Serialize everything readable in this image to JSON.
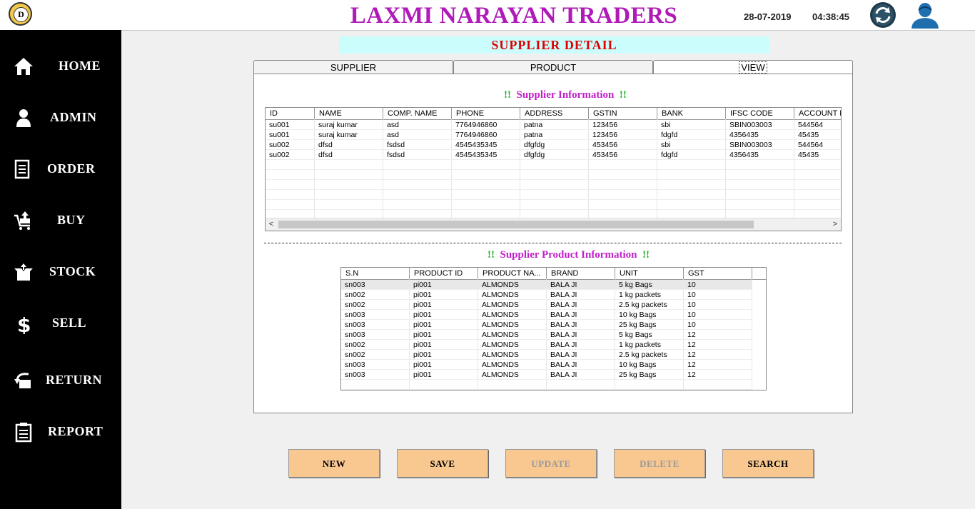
{
  "app": {
    "title": "LAXMI NARAYAN TRADERS",
    "date": "28-07-2019",
    "time": "04:38:45",
    "logo_letter": "D"
  },
  "sidebar": {
    "items": [
      {
        "label": "HOME",
        "icon": "home-icon"
      },
      {
        "label": "ADMIN",
        "icon": "person-icon"
      },
      {
        "label": "ORDER",
        "icon": "document-icon"
      },
      {
        "label": "BUY",
        "icon": "cart-icon"
      },
      {
        "label": "STOCK",
        "icon": "box-icon"
      },
      {
        "label": "SELL",
        "icon": "dollar-icon"
      },
      {
        "label": "RETURN",
        "icon": "return-icon"
      },
      {
        "label": "REPORT",
        "icon": "clipboard-icon"
      }
    ]
  },
  "page": {
    "title": "SUPPLIER DETAIL"
  },
  "tabs": [
    {
      "label": "SUPPLIER",
      "active": false
    },
    {
      "label": "PRODUCT",
      "active": false
    },
    {
      "label": "VIEW",
      "active": true
    }
  ],
  "supplier_info": {
    "title": "Supplier Information",
    "marker": "!!",
    "columns": [
      "ID",
      "NAME",
      "COMP. NAME",
      "PHONE",
      "ADDRESS",
      "GSTIN",
      "BANK",
      "IFSC CODE",
      "ACCOUNT N"
    ],
    "rows": [
      [
        "su001",
        "suraj kumar",
        "asd",
        "7764946860",
        "patna",
        "123456",
        "sbi",
        "SBIN003003",
        "544564"
      ],
      [
        "su001",
        "suraj kumar",
        "asd",
        "7764946860",
        "patna",
        "123456",
        " fdgfd",
        " 4356435",
        " 45435"
      ],
      [
        "su002",
        " dfsd",
        " fsdsd",
        "4545435345",
        "dfgfdg",
        " 453456",
        "sbi",
        "SBIN003003",
        "544564"
      ],
      [
        "su002",
        " dfsd",
        " fsdsd",
        "4545435345",
        "dfgfdg",
        " 453456",
        " fdgfd",
        " 4356435",
        " 45435"
      ]
    ]
  },
  "product_info": {
    "title": "Supplier Product Information",
    "marker": "!!",
    "columns": [
      "S.N",
      "PRODUCT ID",
      "PRODUCT NA...",
      "BRAND",
      "UNIT",
      "GST"
    ],
    "rows": [
      [
        "sn003",
        "pi001",
        "ALMONDS",
        "BALA JI",
        "5 kg Bags",
        "10"
      ],
      [
        "sn002",
        "pi001",
        "ALMONDS",
        "BALA JI",
        "1 kg packets",
        "10"
      ],
      [
        "sn002",
        "pi001",
        "ALMONDS",
        "BALA JI",
        "2.5 kg packets",
        "10"
      ],
      [
        "sn003",
        "pi001",
        "ALMONDS",
        "BALA JI",
        "10 kg Bags",
        "10"
      ],
      [
        "sn003",
        "pi001",
        "ALMONDS",
        "BALA JI",
        "25 kg Bags",
        "10"
      ],
      [
        "sn003",
        "pi001",
        "ALMONDS",
        "BALA JI",
        "5 kg Bags",
        "12"
      ],
      [
        "sn002",
        "pi001",
        "ALMONDS",
        "BALA JI",
        "1 kg packets",
        "12"
      ],
      [
        "sn002",
        "pi001",
        "ALMONDS",
        "BALA JI",
        "2.5 kg packets",
        "12"
      ],
      [
        "sn003",
        "pi001",
        "ALMONDS",
        "BALA JI",
        "10 kg Bags",
        "12"
      ],
      [
        "sn003",
        "pi001",
        "ALMONDS",
        "BALA JI",
        "25 kg Bags",
        "12"
      ]
    ]
  },
  "actions": [
    {
      "label": "NEW",
      "enabled": true
    },
    {
      "label": "SAVE",
      "enabled": true
    },
    {
      "label": "UPDATE",
      "enabled": false
    },
    {
      "label": "DELETE",
      "enabled": false
    },
    {
      "label": "SEARCH",
      "enabled": true
    }
  ],
  "colors": {
    "title": "#b01ab8",
    "banner_bg": "#cbfdfd",
    "banner_text": "#e00000",
    "section_title": "#c020c8",
    "marker": "#20b020",
    "button_bg": "#f8c890",
    "sidebar_bg": "#000000"
  }
}
